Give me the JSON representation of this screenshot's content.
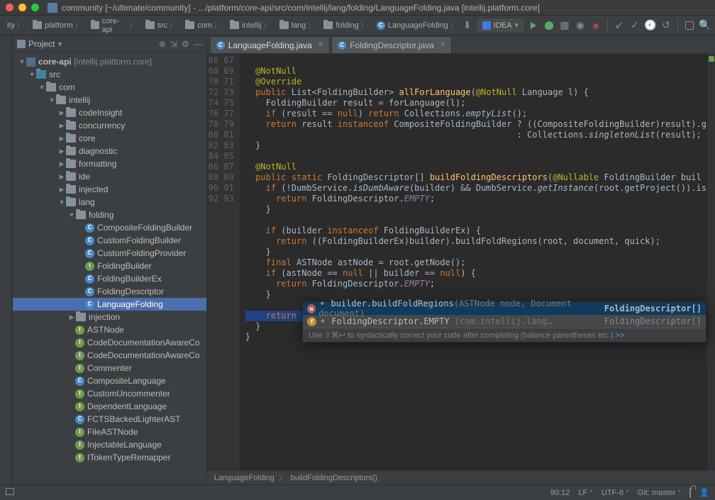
{
  "window": {
    "title": "community [~/ultimate/community] - .../platform/core-api/src/com/intellij/lang/folding/LanguageFolding.java [intellij.platform.core]"
  },
  "breadcrumbs": [
    "ity",
    "platform",
    "core-api",
    "src",
    "com",
    "intellij",
    "lang",
    "folding",
    "LanguageFolding"
  ],
  "runconfig": {
    "name": "IDEA"
  },
  "projectTool": {
    "label": "Project"
  },
  "tree": {
    "root": {
      "name": "core-api",
      "module": "[intellij.platform.core]"
    },
    "src": "src",
    "com": "com",
    "intellij": "intellij",
    "pkgs": [
      "codeInsight",
      "concurrency",
      "core",
      "diagnostic",
      "formatting",
      "ide",
      "injected"
    ],
    "lang": "lang",
    "folding": "folding",
    "foldingItems": [
      "CompositeFoldingBuilder",
      "CustomFoldingBuilder",
      "CustomFoldingProvider",
      "FoldingBuilder",
      "FoldingBuilderEx",
      "FoldingDescriptor",
      "LanguageFolding"
    ],
    "injection": "injection",
    "langClasses": [
      "ASTNode",
      "CodeDocumentationAwareCo",
      "CodeDocumentationAwareCo",
      "Commenter",
      "CompositeLanguage",
      "CustomUncommenter",
      "DependentLanguage",
      "FCTSBackedLighterAST",
      "FileASTNode",
      "InjectableLanguage",
      "ITokenTypeRemapper"
    ]
  },
  "tabs": [
    {
      "name": "LanguageFolding.java",
      "active": true
    },
    {
      "name": "FoldingDescriptor.java",
      "active": false
    }
  ],
  "gutter": {
    "start": 66,
    "end": 93
  },
  "popup": {
    "items": [
      {
        "icon": "m",
        "text": "builder.buildFoldRegions",
        "sig": "(ASTNode node, Document document)",
        "type": "FoldingDescriptor[]"
      },
      {
        "icon": "f",
        "text": "FoldingDescriptor.EMPTY",
        "sig": "(com.intellij.lang…",
        "type": "FoldingDescriptor[]"
      }
    ],
    "hint": "Use ⇧⌘↩ to syntactically correct your code after completing (balance parentheses etc.)  ",
    "hintLink": ">>"
  },
  "editorCrumbs": [
    "LanguageFolding",
    "buildFoldingDescriptors()"
  ],
  "status": {
    "pos": "90:12",
    "lf": "LF",
    "enc": "UTF-8",
    "git": "Git: master"
  }
}
